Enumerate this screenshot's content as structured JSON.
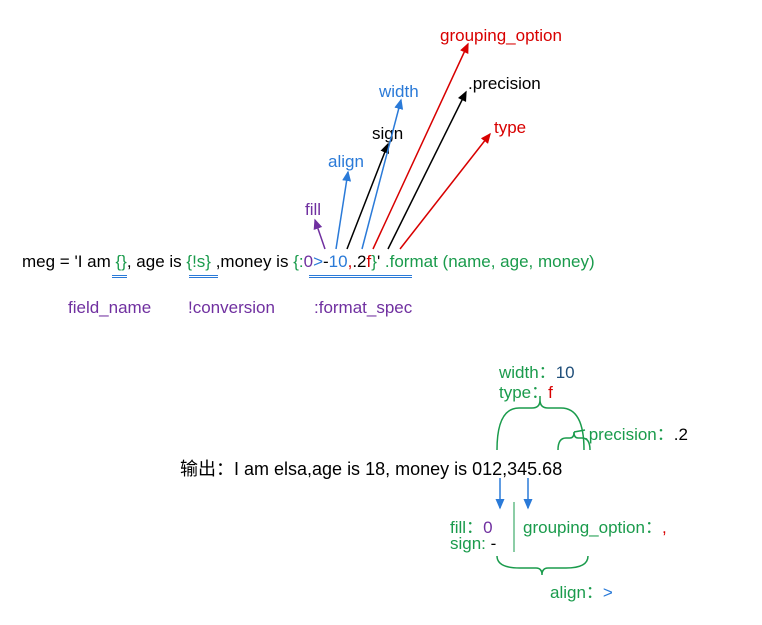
{
  "labels_top": {
    "grouping_option": "grouping_option",
    "precision": ".precision",
    "width": "width",
    "type": "type",
    "sign": "sign",
    "align": "align",
    "fill": "fill"
  },
  "code": {
    "meg_eq": "meg = 'I am ",
    "brace1": "{}",
    "seg_age": ", age is ",
    "brace2": "{!s}",
    "seg_money": " ,money is ",
    "brace3_open": "{:",
    "brace3_fill": "0",
    "brace3_align": ">",
    "brace3_sign": "-",
    "brace3_width": "10",
    "brace3_comma": ",",
    "brace3_prec": ".2",
    "brace3_type": "f",
    "brace3_close": "}",
    "after": "' ",
    "format": ".format ",
    "args": "(name, age, money)"
  },
  "underline_labels": {
    "field_name": "field_name",
    "conversion": "!conversion",
    "format_spec": ":format_spec"
  },
  "right_labels": {
    "width": "width：",
    "width_val": "10",
    "type": "type：",
    "type_val": "f",
    "precision": ".precision：",
    "precision_val": ".2"
  },
  "output_line": {
    "prefix_cn": "输出：",
    "text": "I am elsa,age is 18, money is 012,345.68"
  },
  "bottom_labels": {
    "fill": "fill：",
    "fill_val": "0",
    "sign": "sign: ",
    "sign_val": "-",
    "grouping_option": "grouping_option：",
    "grouping_option_val": ",",
    "align": "align：",
    "align_val": ">"
  },
  "chart_data": {
    "type": "diagram",
    "title": "Python str.format format_spec breakdown",
    "format_spec_parts": {
      "fill": "0",
      "align": ">",
      "sign": "-",
      "width": "10",
      "grouping_option": ",",
      "precision": ".2",
      "type": "f"
    },
    "sample_code": "meg = 'I am {}, age is {!s} ,money is {:0>-10,.2f}' .format (name, age, money)",
    "sample_output": "I am elsa,age is 18, money is 012,345.68",
    "field_annotations": [
      "field_name",
      "!conversion",
      ":format_spec"
    ],
    "example_values": {
      "name": "elsa",
      "age": 18,
      "money_formatted": "012,345.68"
    }
  }
}
